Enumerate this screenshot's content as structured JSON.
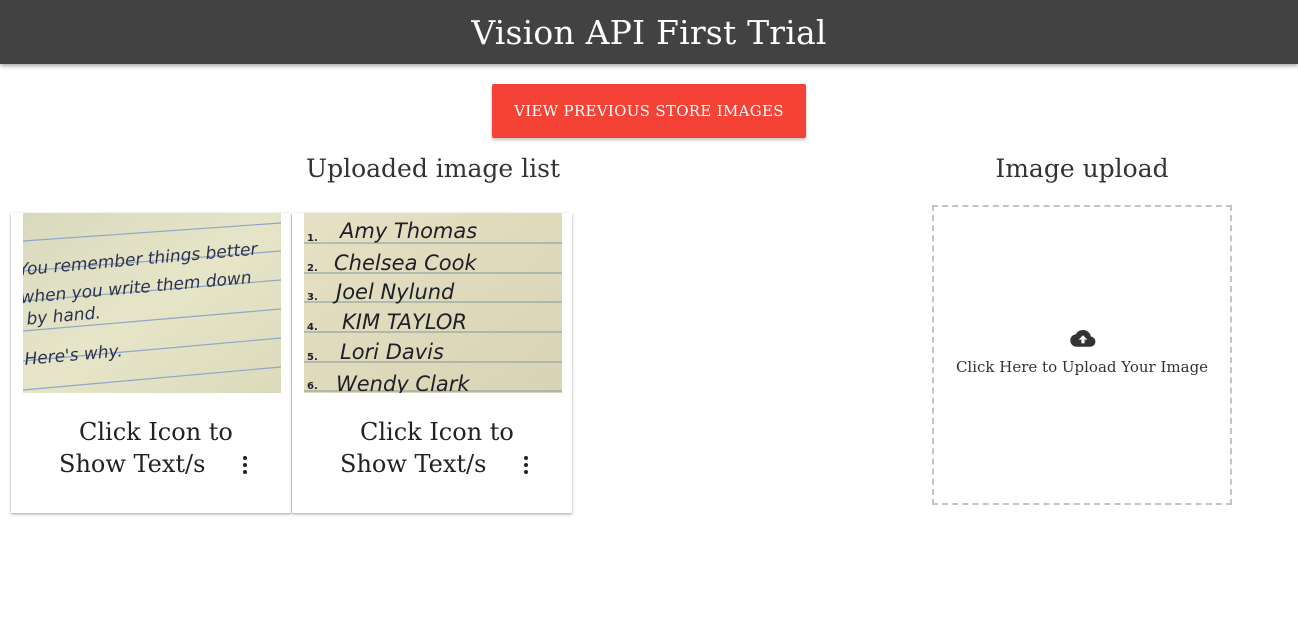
{
  "header": {
    "title": "Vision API First Trial"
  },
  "actions": {
    "view_previous_label": "VIEW PREVIOUS STORE IMAGES"
  },
  "image_list": {
    "title": "Uploaded image list",
    "cards": [
      {
        "caption_line1": "Click Icon to",
        "caption_line2": "Show Text/s",
        "image_text": [
          "You remember things better",
          "when you write them down",
          "by hand.",
          "Here's why."
        ]
      },
      {
        "caption_line1": "Click Icon to",
        "caption_line2": "Show Text/s",
        "image_text": [
          "1.",
          "2.",
          "3.",
          "4.",
          "5.",
          "6.",
          "Amy Thomas",
          "Chelsea Cook",
          "Joel Nylund",
          "KIM TAYLOR",
          "Lori Davis",
          "Wendy Clark"
        ]
      }
    ]
  },
  "upload": {
    "title": "Image upload",
    "prompt": "Click Here to Upload Your Image",
    "icon": "cloud-upload-icon"
  },
  "colors": {
    "header_bg": "#424242",
    "accent": "#f44336",
    "paper": "#e4e3c6"
  }
}
